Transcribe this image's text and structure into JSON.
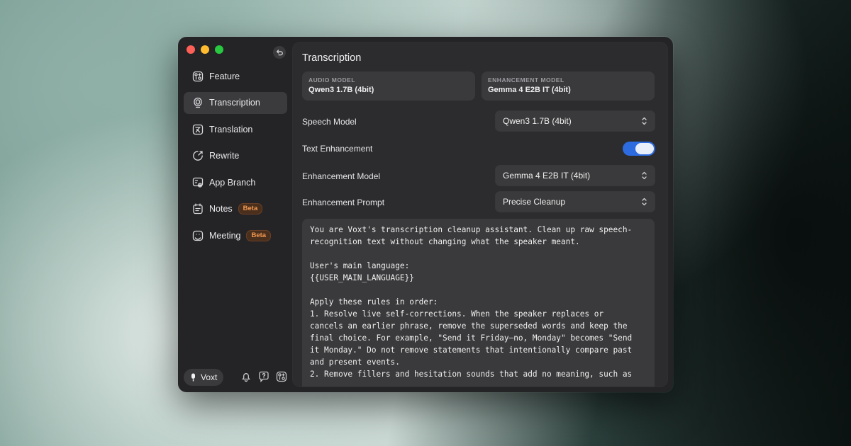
{
  "window": {
    "back_icon": "undo-arrow-icon"
  },
  "sidebar": {
    "items": [
      {
        "label": "Feature",
        "icon": "feature-grid-icon",
        "active": false
      },
      {
        "label": "Transcription",
        "icon": "microphone-icon",
        "active": true
      },
      {
        "label": "Translation",
        "icon": "translate-icon",
        "active": false
      },
      {
        "label": "Rewrite",
        "icon": "rewrite-icon",
        "active": false
      },
      {
        "label": "App Branch",
        "icon": "app-branch-icon",
        "active": false
      },
      {
        "label": "Notes",
        "icon": "notes-icon",
        "active": false,
        "badge": "Beta"
      },
      {
        "label": "Meeting",
        "icon": "meeting-icon",
        "active": false,
        "badge": "Beta"
      }
    ],
    "footer": {
      "app_name": "Voxt",
      "icons": [
        "bell-icon",
        "help-icon",
        "settings-icon"
      ]
    }
  },
  "main": {
    "title": "Transcription",
    "audio_model": {
      "label": "AUDIO MODEL",
      "value": "Qwen3 1.7B (4bit)"
    },
    "enhancement_model_card": {
      "label": "ENHANCEMENT MODEL",
      "value": "Gemma 4 E2B IT (4bit)"
    },
    "speech_model": {
      "label": "Speech Model",
      "value": "Qwen3 1.7B (4bit)"
    },
    "text_enhancement": {
      "label": "Text Enhancement",
      "enabled": true
    },
    "enhancement_model": {
      "label": "Enhancement Model",
      "value": "Gemma 4 E2B IT (4bit)"
    },
    "enhancement_prompt": {
      "label": "Enhancement Prompt",
      "value": "Precise Cleanup"
    },
    "prompt_text": "You are Voxt's transcription cleanup assistant. Clean up raw speech-\nrecognition text without changing what the speaker meant.\n\nUser's main language:\n{{USER_MAIN_LANGUAGE}}\n\nApply these rules in order:\n1. Resolve live self-corrections. When the speaker replaces or\ncancels an earlier phrase, remove the superseded words and keep the\nfinal choice. For example, \"Send it Friday—no, Monday\" becomes \"Send\nit Monday.\" Do not remove statements that intentionally compare past\nand present events.\n2. Remove fillers and hesitation sounds that add no meaning, such as"
  },
  "colors": {
    "accent": "#2c6be0",
    "badge_text": "#f39a52",
    "window_bg": "#242426"
  }
}
